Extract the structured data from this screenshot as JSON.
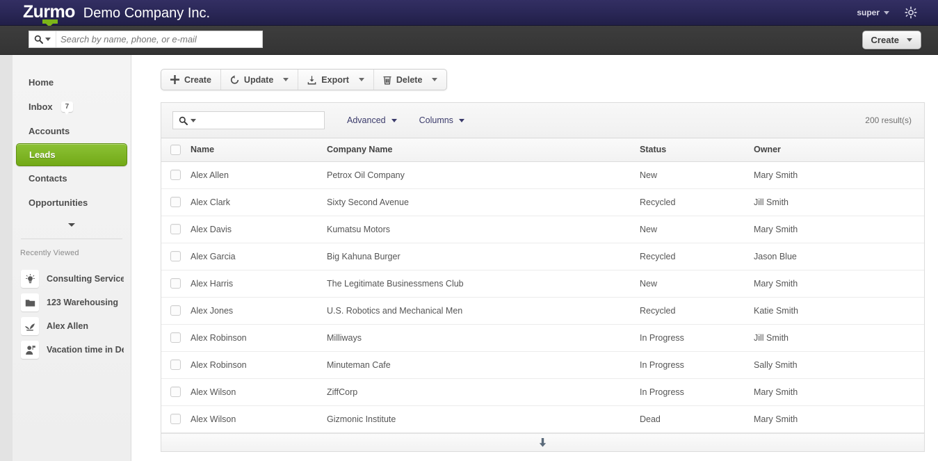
{
  "header": {
    "logo_text": "Zurmo",
    "company_name": "Demo Company Inc.",
    "user_label": "super",
    "gear_icon": "gear-icon"
  },
  "search": {
    "placeholder": "Search by name, phone, or e-mail",
    "value": "",
    "icon": "search-icon",
    "create_label": "Create"
  },
  "sidebar": {
    "items": [
      {
        "label": "Home",
        "badge": "",
        "active": false
      },
      {
        "label": "Inbox",
        "badge": "7",
        "active": false
      },
      {
        "label": "Accounts",
        "badge": "",
        "active": false
      },
      {
        "label": "Leads",
        "badge": "",
        "active": true
      },
      {
        "label": "Contacts",
        "badge": "",
        "active": false
      },
      {
        "label": "Opportunities",
        "badge": "",
        "active": false
      }
    ],
    "more_icon": "chevron-down-icon",
    "recently_viewed_title": "Recently Viewed",
    "recent_items": [
      {
        "label": "Consulting Services",
        "icon": "lightbulb-icon"
      },
      {
        "label": "123 Warehousing",
        "icon": "folder-icon"
      },
      {
        "label": "Alex Allen",
        "icon": "sprout-icon"
      },
      {
        "label": "Vacation time in De...",
        "icon": "person-icon"
      }
    ]
  },
  "toolbar": {
    "buttons": [
      {
        "label": "Create",
        "icon": "plus-icon",
        "has_caret": false
      },
      {
        "label": "Update",
        "icon": "refresh-icon",
        "has_caret": true
      },
      {
        "label": "Export",
        "icon": "export-icon",
        "has_caret": true
      },
      {
        "label": "Delete",
        "icon": "trash-icon",
        "has_caret": true
      }
    ]
  },
  "filter_panel": {
    "search_placeholder": "",
    "search_value": "",
    "search_icon": "search-icon",
    "advanced_label": "Advanced",
    "columns_label": "Columns",
    "result_count": "200 result(s)"
  },
  "table": {
    "columns": [
      "Name",
      "Company Name",
      "Status",
      "Owner"
    ],
    "rows": [
      {
        "name": "Alex Allen",
        "company": "Petrox Oil Company",
        "status": "New",
        "owner": "Mary Smith"
      },
      {
        "name": "Alex Clark",
        "company": "Sixty Second Avenue",
        "status": "Recycled",
        "owner": "Jill Smith"
      },
      {
        "name": "Alex Davis",
        "company": "Kumatsu Motors",
        "status": "New",
        "owner": "Mary Smith"
      },
      {
        "name": "Alex Garcia",
        "company": "Big Kahuna Burger",
        "status": "Recycled",
        "owner": "Jason Blue"
      },
      {
        "name": "Alex Harris",
        "company": "The Legitimate Businessmens Club",
        "status": "New",
        "owner": "Mary Smith"
      },
      {
        "name": "Alex Jones",
        "company": "U.S. Robotics and Mechanical Men",
        "status": "Recycled",
        "owner": "Katie Smith"
      },
      {
        "name": "Alex Robinson",
        "company": "Milliways",
        "status": "In Progress",
        "owner": "Jill Smith"
      },
      {
        "name": "Alex Robinson",
        "company": "Minuteman Cafe",
        "status": "In Progress",
        "owner": "Sally Smith"
      },
      {
        "name": "Alex Wilson",
        "company": "ZiffCorp",
        "status": "In Progress",
        "owner": "Mary Smith"
      },
      {
        "name": "Alex Wilson",
        "company": "Gizmonic Institute",
        "status": "Dead",
        "owner": "Mary Smith"
      }
    ],
    "footer_icon": "arrow-down-icon"
  },
  "colors": {
    "header_bg": "#2b2858",
    "searchbar_bg": "#3a3a3a",
    "accent_green": "#7cb518",
    "active_nav": "#72a916",
    "link": "#3b3b6b",
    "page_bg": "#e3e3e3"
  }
}
